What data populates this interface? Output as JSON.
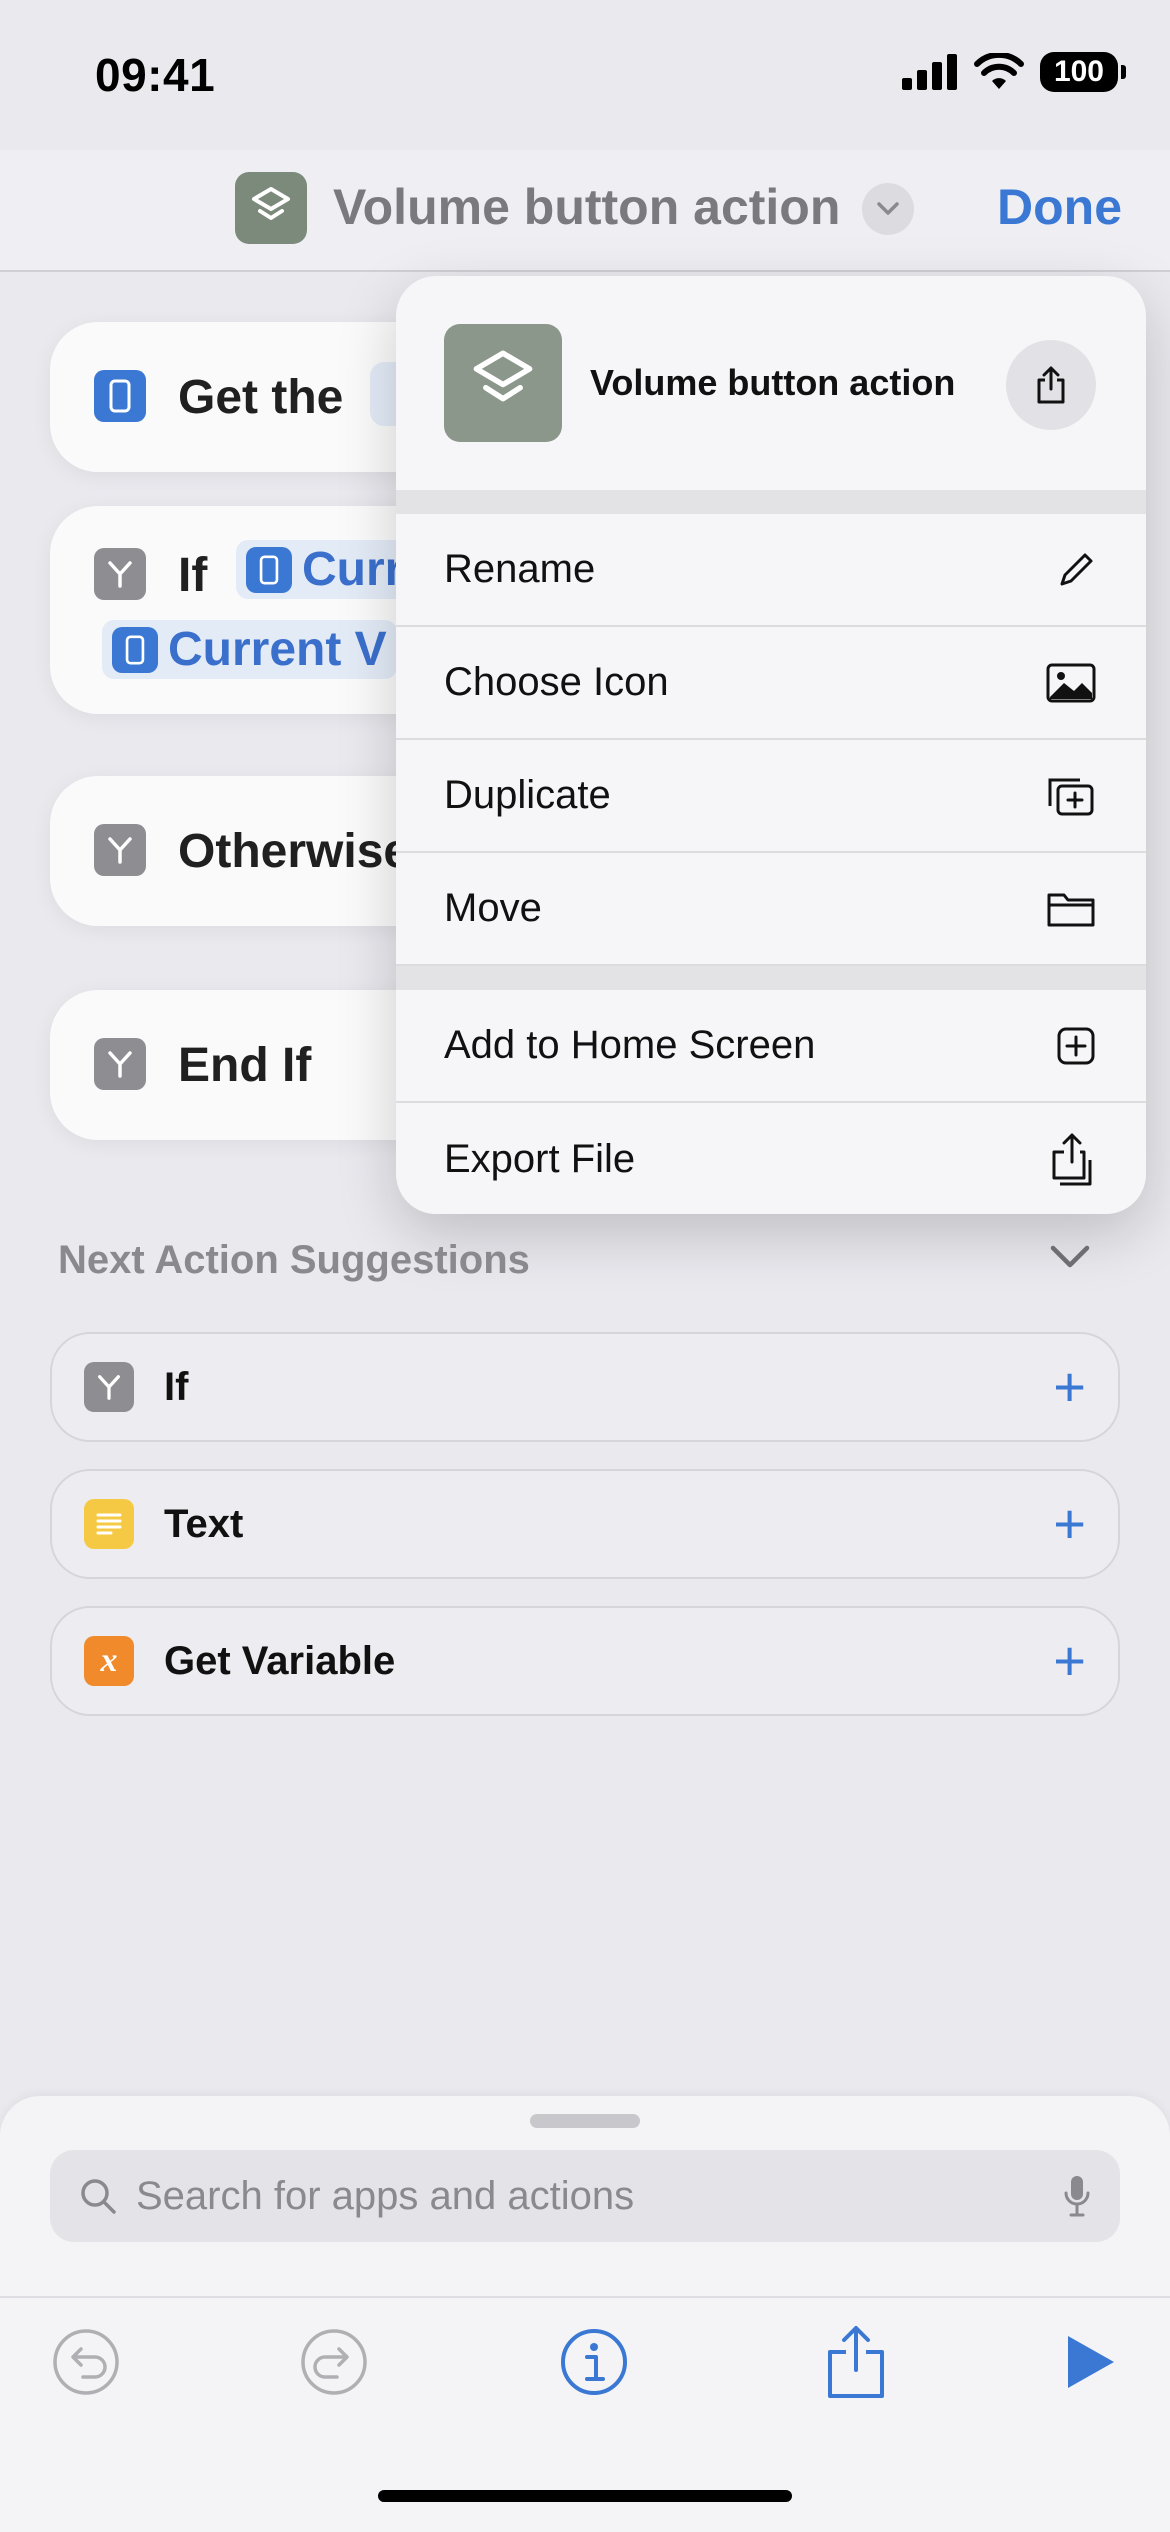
{
  "status_bar": {
    "time": "09:41",
    "battery": "100"
  },
  "nav": {
    "title": "Volume button action",
    "done_label": "Done"
  },
  "actions": {
    "get_text": "Get the",
    "if_text": "If",
    "if_token1": "Curr",
    "if_token2": "Current V",
    "otherwise_text": "Otherwise",
    "endif_text": "End If"
  },
  "menu": {
    "title": "Volume button action",
    "items_group1": [
      {
        "label": "Rename",
        "icon": "pencil-icon"
      },
      {
        "label": "Choose Icon",
        "icon": "image-icon"
      },
      {
        "label": "Duplicate",
        "icon": "duplicate-icon"
      },
      {
        "label": "Move",
        "icon": "folder-icon"
      }
    ],
    "items_group2": [
      {
        "label": "Add to Home Screen",
        "icon": "plus-square-icon"
      },
      {
        "label": "Export File",
        "icon": "export-icon"
      }
    ]
  },
  "suggestions": {
    "title": "Next Action Suggestions",
    "items": [
      {
        "label": "If",
        "icon": "branch-icon",
        "color": "#8d8d92"
      },
      {
        "label": "Text",
        "icon": "text-lines-icon",
        "color": "#f6c945"
      },
      {
        "label": "Get Variable",
        "icon": "variable-x-icon",
        "color": "#f08a2b"
      }
    ]
  },
  "search": {
    "placeholder": "Search for apps and actions"
  },
  "colors": {
    "accent": "#3a78d4",
    "nav_icon_bg": "#7c8a7c"
  }
}
